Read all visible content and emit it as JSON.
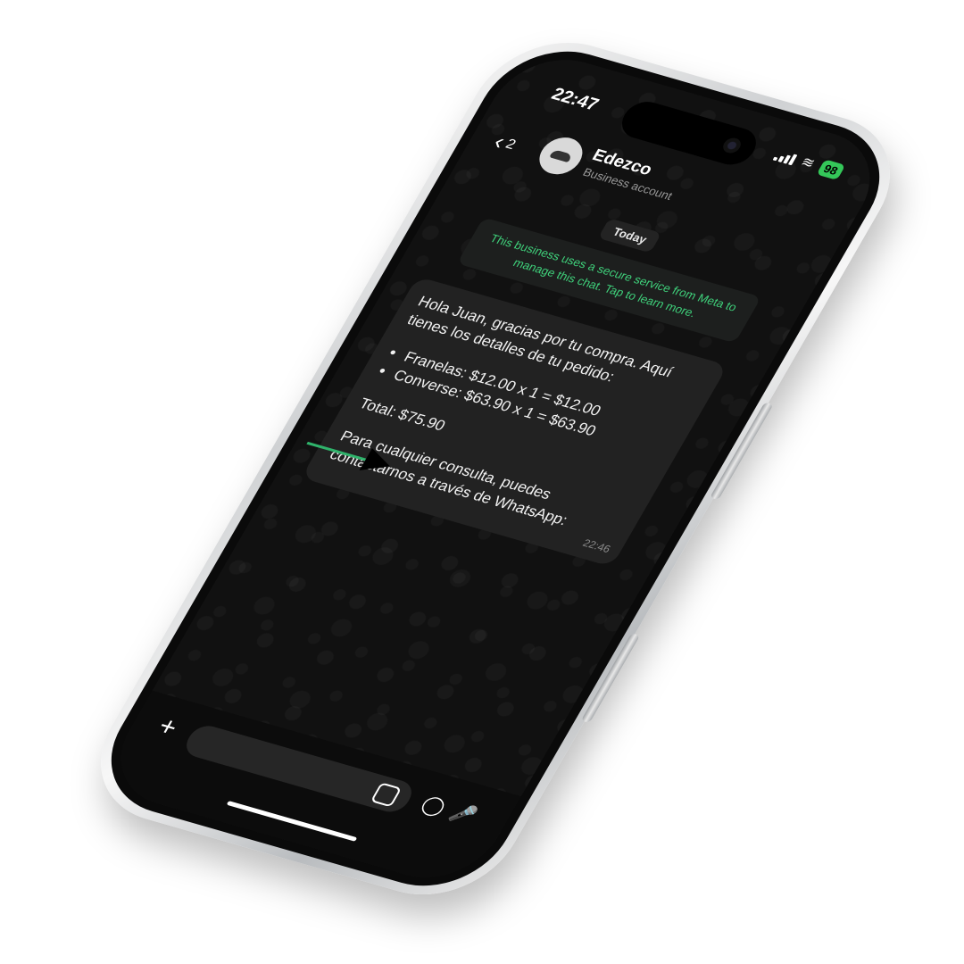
{
  "status": {
    "time": "22:47",
    "battery": "98"
  },
  "header": {
    "back_count": "2",
    "contact_name": "Edezco",
    "contact_subtitle": "Business account"
  },
  "chat": {
    "date_chip": "Today",
    "notice": "This business uses a secure service from Meta to manage this chat. Tap to learn more.",
    "message": {
      "line1": "Hola Juan, gracias por tu compra. Aquí tienes los detalles de tu pedido:",
      "items": [
        "Franelas: $12.00 x 1 = $12.00",
        "Converse: $63.90 x 1 = $63.90"
      ],
      "total": "Total: $75.90",
      "footer": "Para cualquier consulta, puedes contactarnos a través de WhatsApp:",
      "time": "22:46"
    }
  },
  "icons": {
    "back": "chevron-left-icon",
    "plus": "plus-icon",
    "sticker": "sticker-icon",
    "camera": "camera-icon",
    "mic": "mic-icon"
  },
  "colors": {
    "accent_green": "#3fd17b",
    "bubble": "#222222",
    "background": "#111111"
  }
}
